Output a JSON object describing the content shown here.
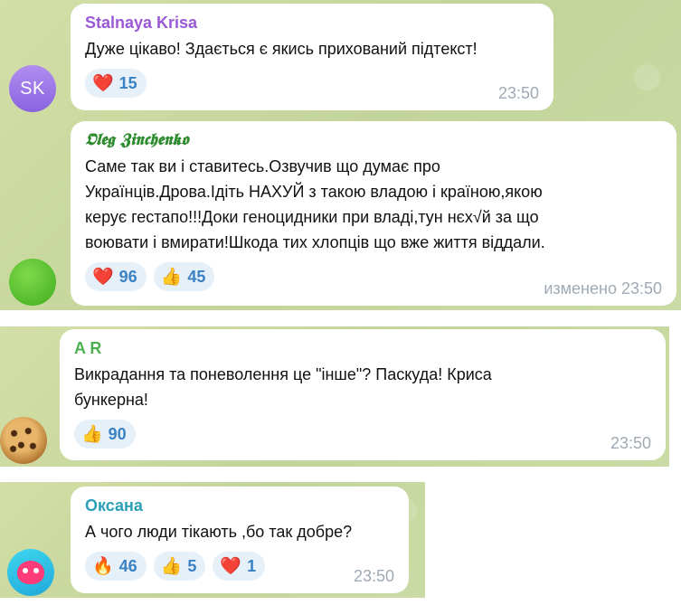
{
  "messages": [
    {
      "author": "Stalnaya Krisa",
      "author_color": "#9b59d6",
      "avatar_initials": "SK",
      "text": "Дуже цікаво! Здається є якись прихований підтекст!",
      "reactions": [
        {
          "emoji": "❤️",
          "count": "15"
        }
      ],
      "time": "23:50"
    },
    {
      "author": "𝕺𝖑𝖊𝖌 𝖅𝖎𝖓𝖈𝖍𝖊𝖓𝖐𝖔",
      "author_color": "#2e8b2e",
      "avatar_initials": "",
      "text_lines": [
        "Саме так ви і ставитесь.Озвучив що думає про",
        "Українців.Дрова.Ідіть НАХУЙ з такою владою і країною,якою",
        "керує гестапо!!!Доки геноцидники при владі,тун нєх√й за що",
        "воювати і вмирати!Шкода тих хлопців що вже життя віддали."
      ],
      "reactions": [
        {
          "emoji": "❤️",
          "count": "96"
        },
        {
          "emoji": "👍",
          "count": "45"
        }
      ],
      "time": "изменено 23:50"
    },
    {
      "author": "A R",
      "author_color": "#4caf50",
      "avatar_initials": "",
      "text_lines": [
        "Викрадання та поневолення це \"інше\"? Паскуда! Криса",
        "бункерна!"
      ],
      "reactions": [
        {
          "emoji": "👍",
          "count": "90"
        }
      ],
      "time": "23:50"
    },
    {
      "author": "Оксана",
      "author_color": "#2a9fb8",
      "avatar_initials": "",
      "text": "А чого люди тікають ,бо так добре?",
      "reactions": [
        {
          "emoji": "🔥",
          "count": "46"
        },
        {
          "emoji": "👍",
          "count": "5"
        },
        {
          "emoji": "❤️",
          "count": "1"
        }
      ],
      "time": "23:50"
    }
  ]
}
